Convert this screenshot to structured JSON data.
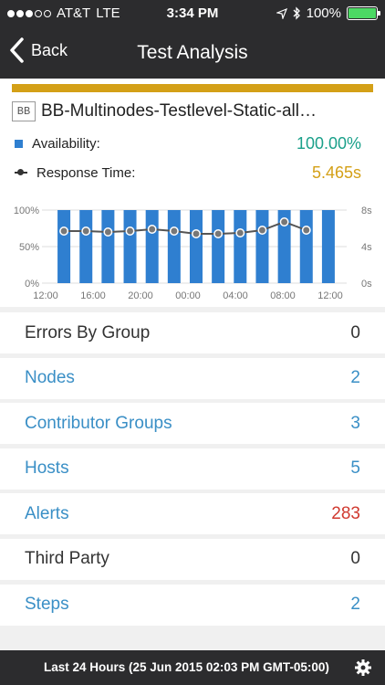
{
  "status": {
    "carrier": "AT&T",
    "network": "LTE",
    "time": "3:34 PM",
    "battery": "100%"
  },
  "nav": {
    "back_label": "Back",
    "title": "Test Analysis"
  },
  "test": {
    "icon_label": "BB",
    "name": "BB-Multinodes-Testlevel-Static-all…",
    "availability_label": "Availability:",
    "availability_value": "100.00%",
    "response_label": "Response Time:",
    "response_value": "5.465s"
  },
  "colors": {
    "accent": "#d4a017",
    "availability_bar": "#2f7fd0",
    "availability_text": "#1aa08a",
    "response_text": "#d4a017",
    "link": "#3a8fc6",
    "alert": "#d0392f"
  },
  "chart_data": {
    "type": "bar",
    "x_ticks": [
      "12:00",
      "16:00",
      "20:00",
      "00:00",
      "04:00",
      "08:00",
      "12:00"
    ],
    "y_left_ticks": [
      "100%",
      "50%",
      "0%"
    ],
    "y_right_ticks": [
      "8s",
      "4s",
      "0s"
    ],
    "ylim_left": [
      0,
      100
    ],
    "ylim_right": [
      0,
      8
    ],
    "grid": true,
    "series": [
      {
        "type": "bar",
        "values": [
          100,
          100,
          100,
          100,
          100,
          100,
          100,
          100,
          100,
          100,
          100,
          100,
          100
        ]
      },
      {
        "type": "line",
        "values": [
          5.7,
          5.7,
          5.6,
          5.7,
          5.9,
          5.7,
          5.4,
          5.4,
          5.5,
          5.8,
          6.7,
          5.8
        ]
      }
    ]
  },
  "list": [
    {
      "label": "Errors By Group",
      "count": "0",
      "link": false,
      "alert": false
    },
    {
      "label": "Nodes",
      "count": "2",
      "link": true,
      "alert": false
    },
    {
      "label": "Contributor Groups",
      "count": "3",
      "link": true,
      "alert": false
    },
    {
      "label": "Hosts",
      "count": "5",
      "link": true,
      "alert": false
    },
    {
      "label": "Alerts",
      "count": "283",
      "link": true,
      "alert": true
    },
    {
      "label": "Third Party",
      "count": "0",
      "link": false,
      "alert": false
    },
    {
      "label": "Steps",
      "count": "2",
      "link": true,
      "alert": false
    }
  ],
  "footer": {
    "range": "Last 24 Hours (25 Jun 2015 02:03 PM GMT-05:00)"
  }
}
